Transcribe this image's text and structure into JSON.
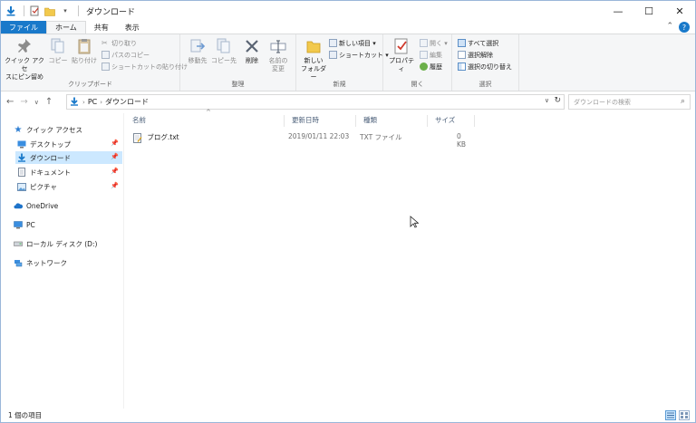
{
  "window": {
    "title": "ダウンロード",
    "controls": {
      "minimize": "—",
      "maximize": "☐",
      "close": "✕"
    }
  },
  "ribbon_tabs": [
    "ファイル",
    "ホーム",
    "共有",
    "表示"
  ],
  "ribbon": {
    "clipboard": {
      "pin_label_1": "クイック アクセ",
      "pin_label_2": "スにピン留め",
      "copy": "コピー",
      "paste": "貼り付け",
      "cut": "切り取り",
      "copy_path": "パスのコピー",
      "paste_shortcut": "ショートカットの貼り付け",
      "group": "クリップボード"
    },
    "organize": {
      "move_to": "移動先",
      "copy_to": "コピー先",
      "delete": "削除",
      "rename_1": "名前の",
      "rename_2": "変更",
      "group": "整理"
    },
    "new": {
      "new_folder_1": "新しい",
      "new_folder_2": "フォルダー",
      "new_item": "新しい項目 ▾",
      "shortcut": "ショートカット ▾",
      "group": "新規"
    },
    "open": {
      "properties": "プロパティ",
      "open": "開く ▾",
      "edit": "編集",
      "history": "履歴",
      "group": "開く"
    },
    "select": {
      "select_all": "すべて選択",
      "select_none": "選択解除",
      "invert": "選択の切り替え",
      "group": "選択"
    }
  },
  "address": {
    "crumbs": [
      "PC",
      "ダウンロード"
    ],
    "search_placeholder": "ダウンロードの検索"
  },
  "nav_pane": {
    "quick_access": "クイック アクセス",
    "desktop": "デスクトップ",
    "downloads": "ダウンロード",
    "documents": "ドキュメント",
    "pictures": "ピクチャ",
    "onedrive": "OneDrive",
    "pc": "PC",
    "local_disk": "ローカル ディスク (D:)",
    "network": "ネットワーク"
  },
  "columns": {
    "name": "名前",
    "date": "更新日時",
    "type": "種類",
    "size": "サイズ"
  },
  "files": [
    {
      "name": "ブログ.txt",
      "date": "2019/01/11 22:03",
      "type": "TXT ファイル",
      "size": "0 KB"
    }
  ],
  "status": {
    "count": "1 個の項目"
  },
  "colors": {
    "accent": "#1979ca",
    "selection": "#cce8ff",
    "ribbon_bg": "#f5f6f7"
  }
}
